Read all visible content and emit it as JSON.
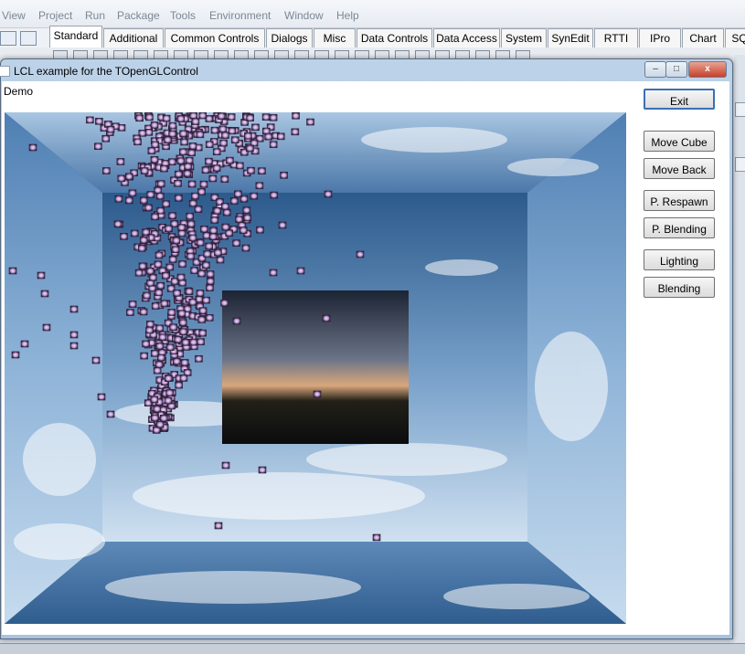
{
  "ide": {
    "menu": [
      "View",
      "Project",
      "Run",
      "Package",
      "Tools",
      "Environment",
      "Window",
      "Help"
    ],
    "palette_tabs": [
      "Standard",
      "Additional",
      "Common Controls",
      "Dialogs",
      "Misc",
      "Data Controls",
      "Data Access",
      "System",
      "SynEdit",
      "RTTI",
      "IPro",
      "Chart",
      "SQ"
    ],
    "active_tab": "Standard"
  },
  "window": {
    "title": "LCL example for the TOpenGLControl",
    "menu_label": "Demo",
    "caption_buttons": {
      "minimize": "–",
      "maximize": "□",
      "close": "x"
    }
  },
  "buttons": {
    "exit": "Exit",
    "move_cube": "Move Cube",
    "move_back": "Move Back",
    "p_respawn": "P. Respawn",
    "p_blending": "P. Blending",
    "lighting": "Lighting",
    "blending": "Blending"
  },
  "colors": {
    "sky_light": "#c9dcee",
    "sky_dark": "#2f5d8e",
    "particle": "#c8a6d8",
    "sunset_dark": "#1a2130",
    "sunset_glow": "#d9a77c"
  }
}
